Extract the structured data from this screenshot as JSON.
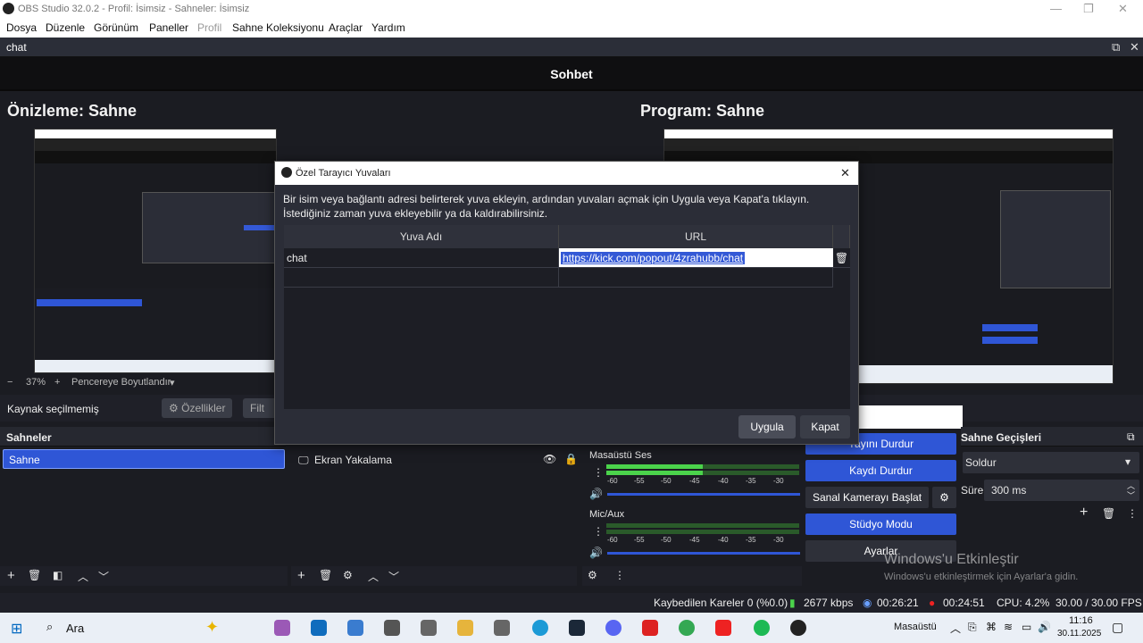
{
  "window": {
    "title": "OBS Studio 32.0.2 - Profil: İsimsiz - Sahneler: İsimsiz"
  },
  "menu": {
    "items": [
      "Dosya",
      "Düzenle",
      "Görünüm",
      "Paneller",
      "Profil",
      "Sahne Koleksiyonu",
      "Araçlar",
      "Yardım"
    ]
  },
  "chat_dock": {
    "label": "chat",
    "heading": "Sohbet"
  },
  "preview": {
    "title": "Önizleme: Sahne"
  },
  "program": {
    "title": "Program: Sahne"
  },
  "zoom": {
    "level": "37%",
    "fit_label": "Pencereye Boyutlandır"
  },
  "source_toolbar": {
    "no_selection": "Kaynak seçilmemiş",
    "properties": "Özellikler",
    "filters": "Filt"
  },
  "scenes": {
    "header": "Sahneler",
    "items": [
      "Sahne"
    ]
  },
  "sources": {
    "items": [
      "Ekran Yakalama"
    ]
  },
  "mixer": {
    "channels": [
      {
        "name": "Masaüstü Ses",
        "level": 0.5
      },
      {
        "name": "Mic/Aux",
        "level": 0.0
      }
    ],
    "ticks": [
      "-60",
      "-55",
      "-50",
      "-45",
      "-40",
      "-35",
      "-30"
    ]
  },
  "controls": {
    "stop_stream": "Yayını Durdur",
    "stop_record": "Kaydı Durdur",
    "virtual_cam": "Sanal Kamerayı Başlat",
    "studio_mode": "Stüdyo Modu",
    "settings": "Ayarlar"
  },
  "transitions": {
    "header": "Sahne Geçişleri",
    "type": "Soldur",
    "duration_label": "Süre",
    "duration_value": "300 ms"
  },
  "dialog": {
    "title": "Özel Tarayıcı Yuvaları",
    "description": "Bir isim veya bağlantı adresi belirterek yuva ekleyin, ardından yuvaları açmak için Uygula veya Kapat'a tıklayın. İstediğiniz zaman yuva ekleyebilir ya da kaldırabilirsiniz.",
    "col_name": "Yuva Adı",
    "col_url": "URL",
    "rows": [
      {
        "name": "chat",
        "url": "https://kick.com/popout/4zrahubb/chat"
      }
    ],
    "apply": "Uygula",
    "close": "Kapat"
  },
  "status": {
    "dropped": "Kaybedilen Kareler 0 (%0.0)",
    "bitrate": "2677 kbps",
    "stream_time": "00:26:21",
    "rec_time": "00:24:51",
    "cpu": "CPU: 4.2%",
    "fps": "30.00 / 30.00 FPS"
  },
  "watermark": {
    "line1": "Windows'u Etkinleştir",
    "line2": "Windows'u etkinleştirmek için Ayarlar'a gidin."
  },
  "taskbar": {
    "search": "Ara",
    "tray_label": "Masaüstü",
    "time": "11:16",
    "date": "30.11.2025"
  }
}
